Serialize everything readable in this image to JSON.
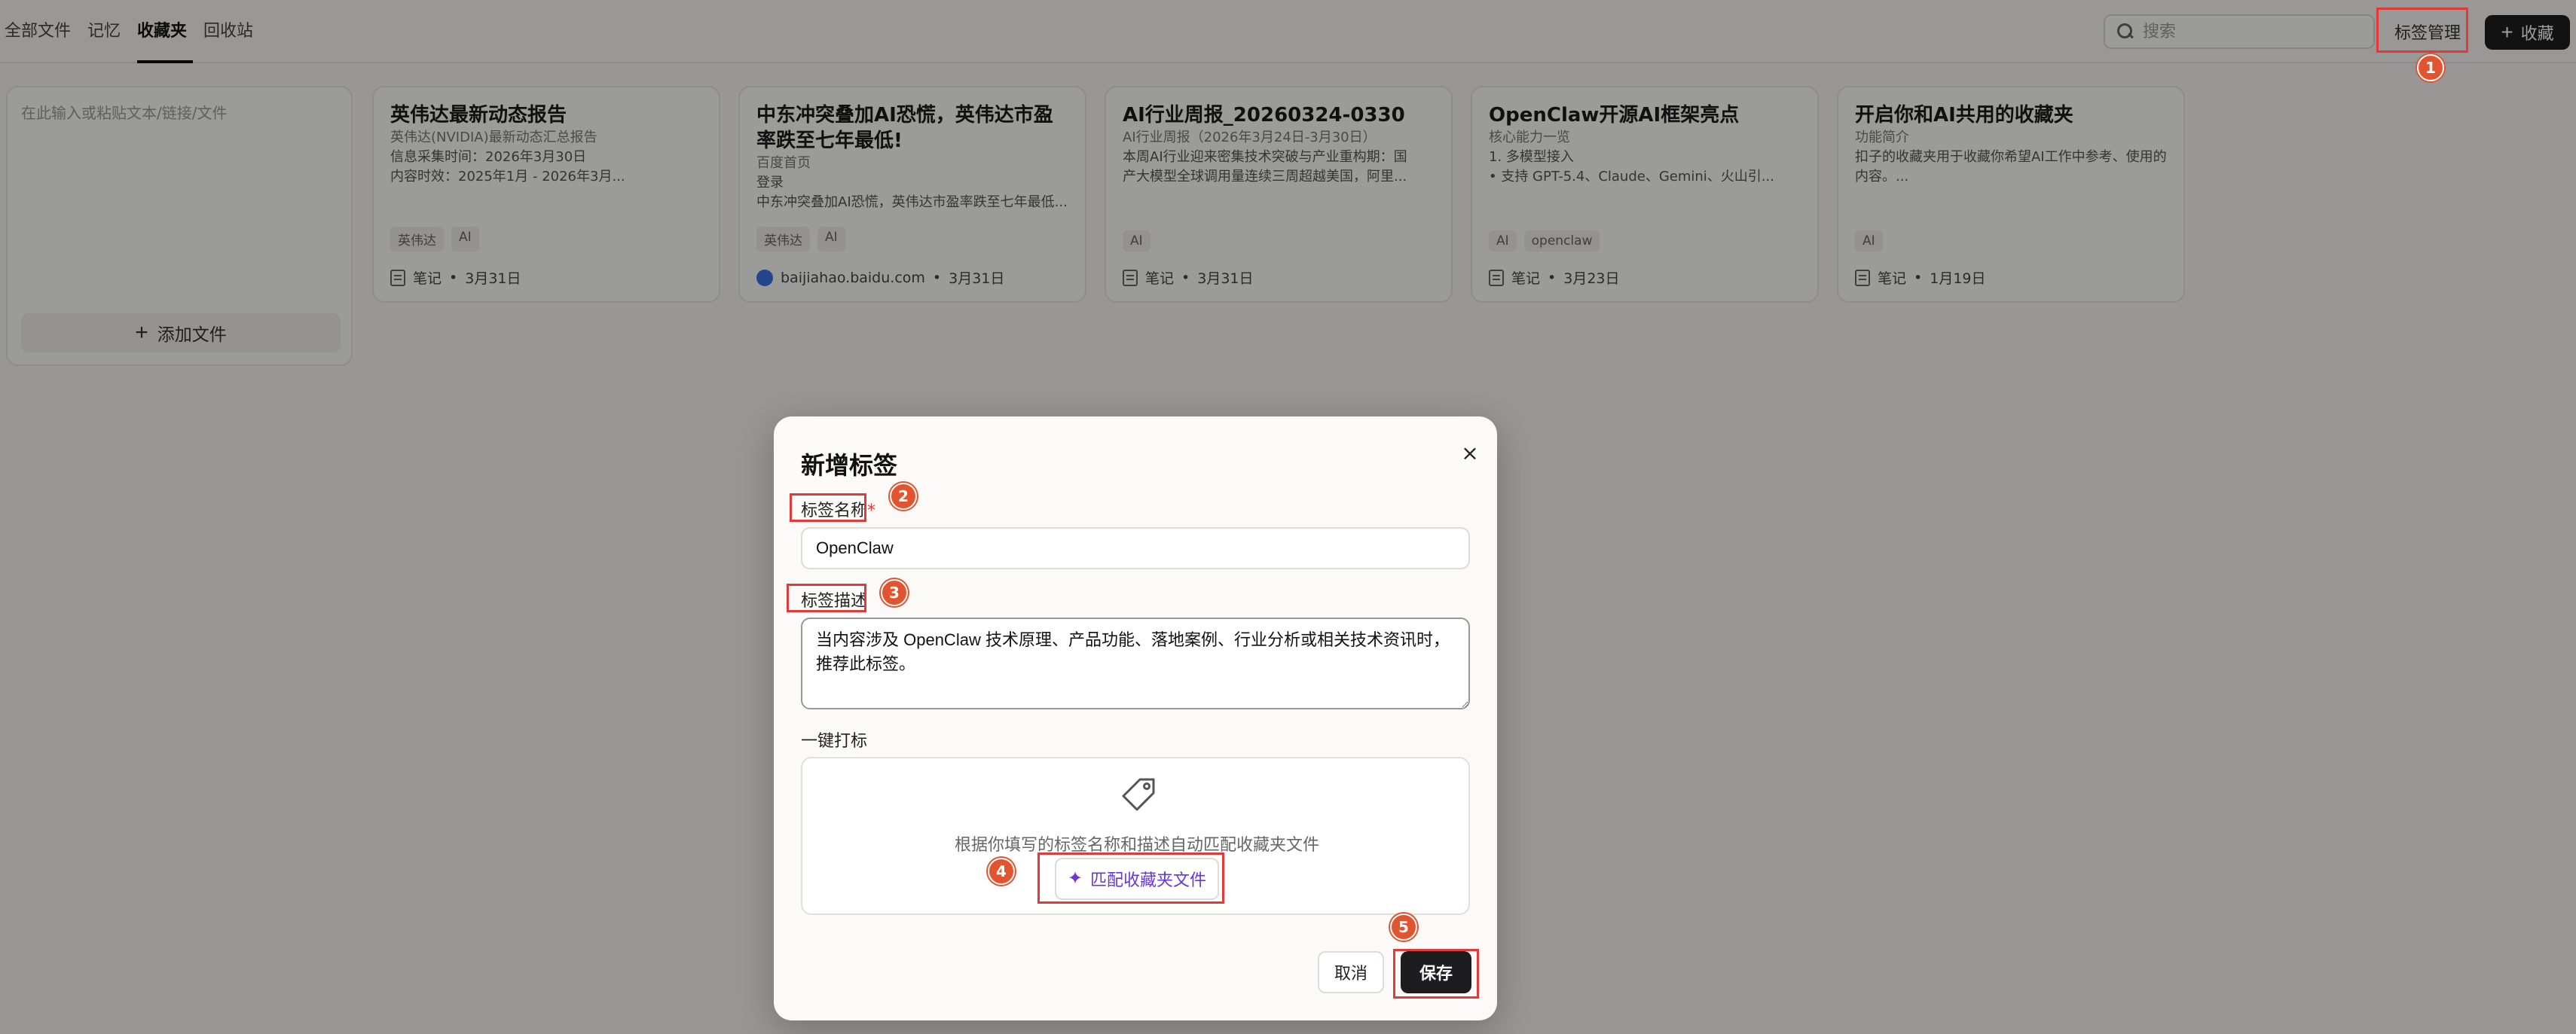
{
  "tabs": [
    {
      "label": "全部文件"
    },
    {
      "label": "记忆"
    },
    {
      "label": "收藏夹"
    },
    {
      "label": "回收站"
    }
  ],
  "active_tab": "收藏夹",
  "search": {
    "placeholder": "搜索"
  },
  "header": {
    "tag_management_label": "标签管理",
    "favorite_label": "收藏"
  },
  "quick_note": {
    "placeholder": "在此输入或粘贴文本/链接/文件",
    "add_file_label": "添加文件"
  },
  "cards": [
    {
      "title": "英伟达最新动态报告",
      "lines": [
        "英伟达(NVIDIA)最新动态汇总报告",
        "信息采集时间：2026年3月30日",
        "内容时效：2025年1月 - 2026年3月..."
      ],
      "tags": [
        "英伟达",
        "AI"
      ],
      "source": "笔记",
      "date": "3月31日"
    },
    {
      "title": "中东冲突叠加AI恐慌，英伟达市盈率跌至七年最低!",
      "lines": [
        "百度首页",
        "登录",
        "中东冲突叠加AI恐慌，英伟达市盈率跌至七年最低..."
      ],
      "tags": [
        "英伟达",
        "AI"
      ],
      "source": "baijiahao.baidu.com",
      "date": "3月31日"
    },
    {
      "title": "AI行业周报_20260324-0330",
      "lines": [
        "AI行业周报（2026年3月24日-3月30日）",
        "本周AI行业迎来密集技术突破与产业重构期：国",
        "产大模型全球调用量连续三周超越美国，阿里..."
      ],
      "tags": [
        "AI"
      ],
      "source": "笔记",
      "date": "3月31日"
    },
    {
      "title": "OpenClaw开源AI框架亮点",
      "lines": [
        "核心能力一览",
        "1. 多模型接入",
        "• 支持 GPT-5.4、Claude、Gemini、火山引..."
      ],
      "tags": [
        "AI",
        "openclaw"
      ],
      "source": "笔记",
      "date": "3月23日"
    },
    {
      "title": "开启你和AI共用的收藏夹",
      "lines": [
        "功能简介",
        "扣子的收藏夹用于收藏你希望AI工作中参考、使用的",
        "内容。..."
      ],
      "tags": [
        "AI"
      ],
      "source": "笔记",
      "date": "1月19日"
    }
  ],
  "modal": {
    "title": "新增标签",
    "close_symbol": "×",
    "name_label": "标签名称",
    "required_mark": "*",
    "name_value": "OpenClaw",
    "desc_label": "标签描述",
    "desc_value": "当内容涉及 OpenClaw 技术原理、产品功能、落地案例、行业分析或相关技术资讯时，推荐此标签。",
    "auto_tag_label": "一键打标",
    "match_hint": "根据你填写的标签名称和描述自动匹配收藏夹文件",
    "match_button": "匹配收藏夹文件",
    "cancel": "取消",
    "save": "保存"
  },
  "annotations": [
    "1",
    "2",
    "3",
    "4",
    "5"
  ],
  "colors": {
    "accent_purple": "#6a36d6",
    "annotation_red": "#e03b3b",
    "badge_orange": "#e2542f",
    "dark_button": "#1d1d1f"
  }
}
